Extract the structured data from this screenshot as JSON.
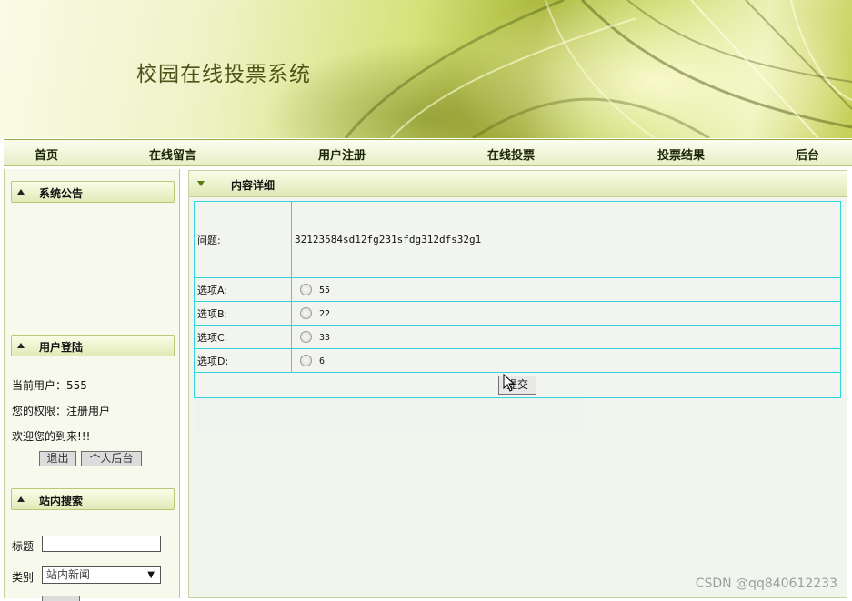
{
  "site": {
    "title": "校园在线投票系统"
  },
  "nav": [
    "首页",
    "在线留言",
    "用户注册",
    "在线投票",
    "投票结果",
    "后台"
  ],
  "sidebar": {
    "notice": {
      "title": "系统公告"
    },
    "login": {
      "title": "用户登陆",
      "current_user": "当前用户：555",
      "role": "您的权限：注册用户",
      "welcome": "欢迎您的到来!!!",
      "logout_label": "退出",
      "profile_label": "个人后台"
    },
    "search": {
      "title": "站内搜索",
      "title_label": "标题",
      "title_value": "",
      "category_label": "类别",
      "category_value": "站内新闻"
    }
  },
  "main": {
    "header": "内容详细",
    "question_label": "问题:",
    "question_text": "32123584sd12fg231sfdg312dfs32g1",
    "options": [
      {
        "label": "选项A:",
        "value": "55"
      },
      {
        "label": "选项B:",
        "value": "22"
      },
      {
        "label": "选项C:",
        "value": "33"
      },
      {
        "label": "选项D:",
        "value": "6"
      }
    ],
    "submit_label": "提交"
  },
  "watermark": "CSDN @qq840612233"
}
